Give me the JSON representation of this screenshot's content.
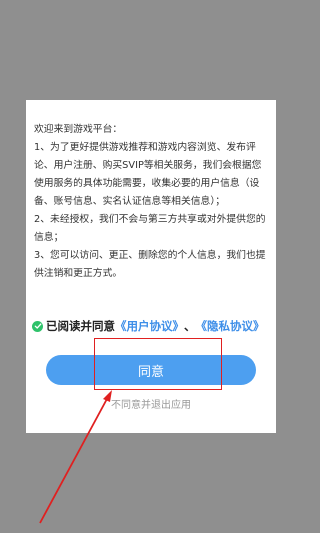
{
  "dialog": {
    "paragraphs": [
      "欢迎来到游戏平台：",
      "1、为了更好提供游戏推荐和游戏内容浏览、发布评论、用户注册、购买SVIP等相关服务，我们会根据您使用服务的具体功能需要，收集必要的用户信息（设备、账号信息、实名认证信息等相关信息）；",
      "2、未经授权，我们不会与第三方共享或对外提供您的信息；",
      "3、您可以访问、更正、删除您的个人信息，我们也提供注销和更正方式。"
    ],
    "agree_label": "已阅读并同意",
    "user_agreement_link": "《用户协议》",
    "separator": "、",
    "privacy_link": "《隐私协议》",
    "confirm_button": "同意",
    "decline_link": "不同意并退出应用"
  },
  "colors": {
    "overlay": "#8f8f8f",
    "button": "#4d9ff0",
    "link": "#3d8ee8",
    "check": "#2ec26a",
    "annotation": "#e02020"
  },
  "icons": {
    "check": "check-circle-icon",
    "arrow": "annotation-arrow"
  }
}
